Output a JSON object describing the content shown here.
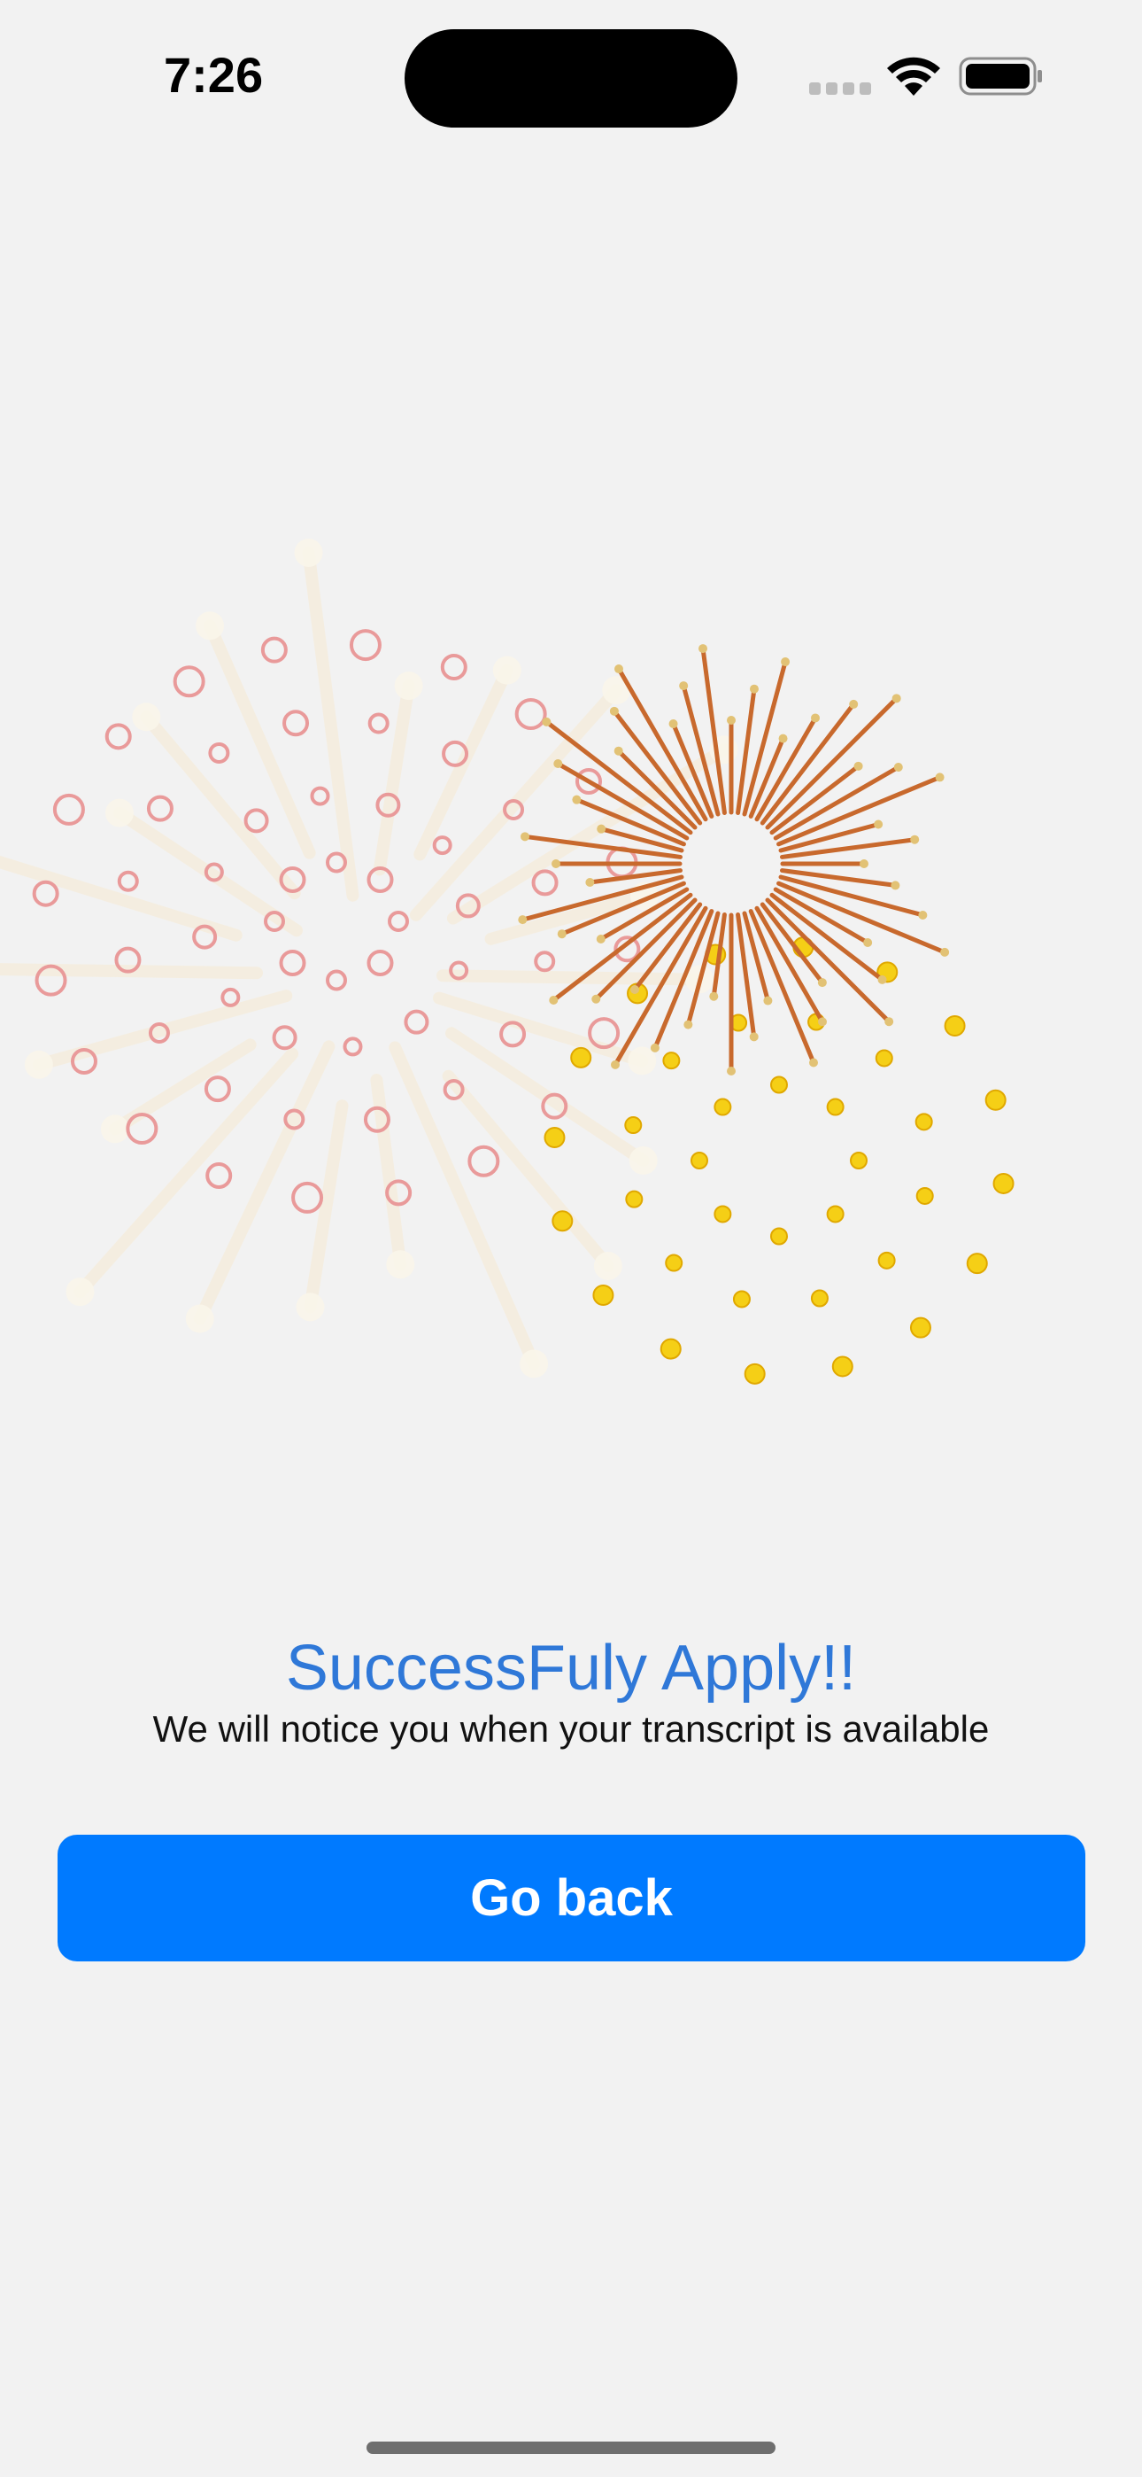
{
  "status_bar": {
    "time": "7:26",
    "icons": [
      "cellular-signal-icon",
      "wifi-icon",
      "battery-icon"
    ]
  },
  "animation": {
    "name": "fireworks-celebration",
    "colors": {
      "pink_rings": "#e99a9a",
      "orange_rays": "#c8692d",
      "ray_tips": "#e2c275",
      "gold_dots": "#f5cf16",
      "faded_trails": "#f6ecd9"
    }
  },
  "message": {
    "title": "SuccessFuly Apply!!",
    "subtitle": "We will notice you when your transcript is available"
  },
  "actions": {
    "go_back_label": "Go back"
  },
  "theme": {
    "background": "#f2f2f2",
    "accent": "#007aff",
    "title_color": "#2f78d8"
  }
}
